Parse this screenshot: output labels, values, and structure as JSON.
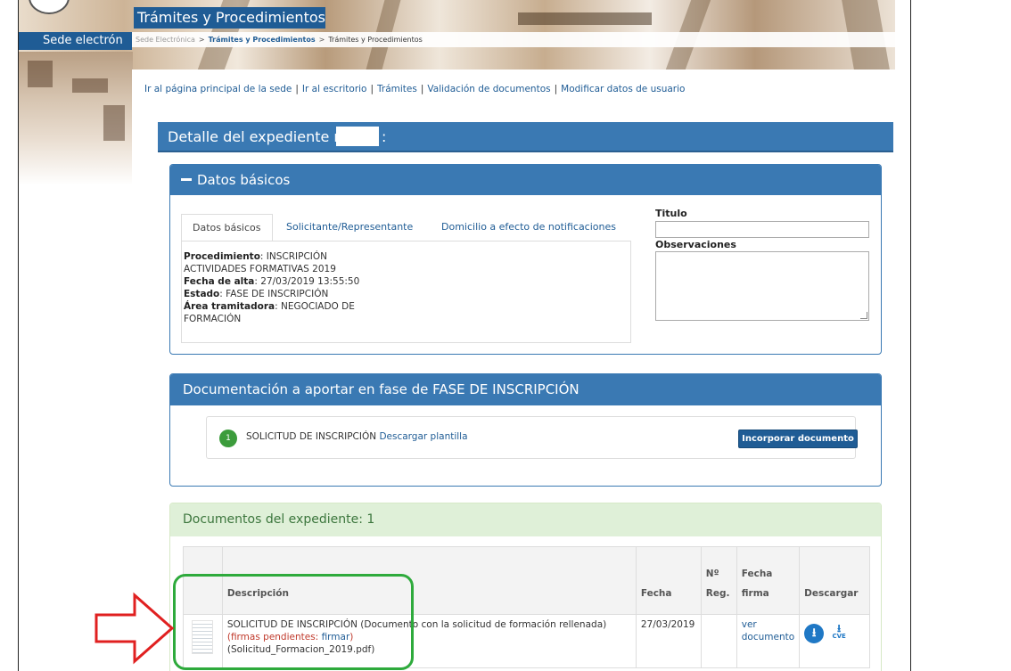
{
  "header": {
    "title": "Trámites y Procedimientos",
    "sede": "Sede electrón",
    "breadcrumb": [
      "Sede Electrónica",
      "Trámites y Procedimientos",
      "Trámites y Procedimientos"
    ],
    "breadcrumb_sep": ">"
  },
  "nav_links": [
    "Ir al página principal de la sede",
    "Ir al escritorio",
    "Trámites",
    "Validación de documentos",
    "Modificar datos de usuario"
  ],
  "nav_sep": "|",
  "detalle": {
    "label": "Detalle del expediente nº",
    "colon": ":"
  },
  "datos_basicos": {
    "panel_title": "Datos básicos",
    "tabs": [
      "Datos básicos",
      "Solicitante/Representante",
      "Domicilio a efecto de notificaciones"
    ],
    "fields": [
      {
        "label": "Procedimiento",
        "value": ": INSCRIPCIÓN ACTIVIDADES FORMATIVAS 2019"
      },
      {
        "label": "Fecha de alta",
        "value": ": 27/03/2019 13:55:50"
      },
      {
        "label": "Estado",
        "value": ": FASE DE INSCRIPCIÓN"
      },
      {
        "label": "Área tramitadora",
        "value": ": NEGOCIADO DE FORMACIÓN"
      }
    ],
    "titulo_label": "Titulo",
    "titulo_value": "",
    "observaciones_label": "Observaciones",
    "observaciones_value": ""
  },
  "documentacion": {
    "panel_title": "Documentación a aportar en fase de FASE DE INSCRIPCIÓN",
    "item": {
      "number": "1",
      "name": "SOLICITUD DE INSCRIPCIÓN",
      "template_link": "Descargar plantilla",
      "button": "Incorporar documento"
    }
  },
  "documentos": {
    "panel_title": "Documentos del expediente: 1",
    "columns": [
      "",
      "Descripción",
      "Fecha",
      "Nº Reg.",
      "Fecha firma",
      "Descargar"
    ],
    "rows": [
      {
        "description": "SOLICITUD DE INSCRIPCIÓN (Documento con la solicitud de formación rellenada)",
        "pending_open": "(firmas pendientes: ",
        "pending_link": "firmar",
        "pending_close": ")",
        "filename": "(Solicitud_Formacion_2019.pdf)",
        "fecha": "27/03/2019",
        "nreg": "",
        "fecha_firma_link": "ver documento",
        "download_icon": "download-circle-icon",
        "cve_label": "CVE"
      }
    ]
  },
  "colors": {
    "primary_blue": "#3a79b3",
    "dark_blue": "#1f5c95",
    "success_bg": "#dff0d8",
    "success_text": "#3c763d",
    "badge_green": "#3c9c3c",
    "annotation_green": "#2eaa3c",
    "annotation_red": "#e02020",
    "pending_red": "#c0392b"
  }
}
